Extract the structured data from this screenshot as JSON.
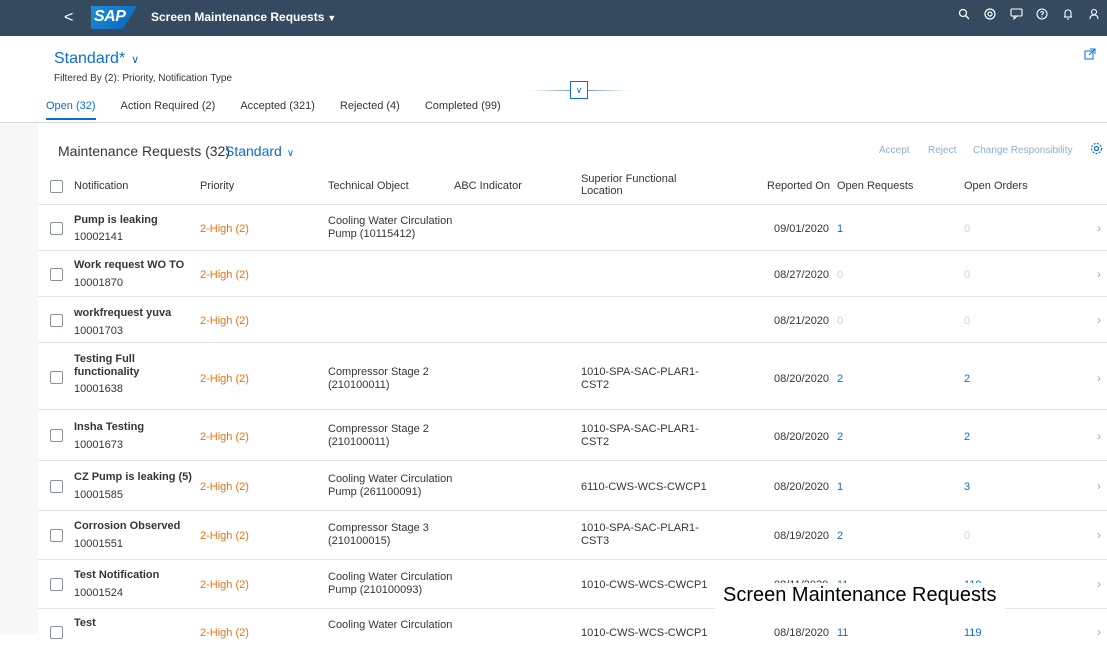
{
  "shell": {
    "back_icon": "<",
    "logo_text": "SAP",
    "app_title": "Screen Maintenance Requests",
    "title_caret": "▼",
    "actions": [
      "search-icon",
      "copilot-icon",
      "notifications-chat-icon",
      "help-icon",
      "bell-icon",
      "user-icon"
    ]
  },
  "header": {
    "variant_name": "Standard*",
    "variant_chevron": "∨",
    "filtered_by": "Filtered By (2): Priority, Notification Type",
    "share_icon": "↗",
    "collapse_icon": "∨",
    "tabs": [
      {
        "label": "Open (32)",
        "active": true
      },
      {
        "label": "Action Required (2)",
        "active": false
      },
      {
        "label": "Accepted (321)",
        "active": false
      },
      {
        "label": "Rejected (4)",
        "active": false
      },
      {
        "label": "Completed (99)",
        "active": false
      }
    ]
  },
  "table": {
    "title": "Maintenance Requests (32)",
    "variant": "Standard",
    "variant_chevron": "∨",
    "actions": {
      "accept": "Accept",
      "reject": "Reject",
      "change_responsibility": "Change Responsibility"
    },
    "settings_icon": "⚙",
    "columns": {
      "notification": "Notification",
      "priority": "Priority",
      "technical_object": "Technical Object",
      "abc_indicator": "ABC Indicator",
      "superior_functional_location": "Superior Functional Location",
      "reported_on": "Reported On",
      "open_requests": "Open Requests",
      "open_orders": "Open Orders"
    },
    "rows": [
      {
        "title": "Pump is leaking",
        "id": "10002141",
        "priority": "2-High (2)",
        "technical_object": "Cooling Water Circulation Pump (10115412)",
        "functional_location": "",
        "reported_on": "09/01/2020",
        "open_requests": "1",
        "open_orders": "0"
      },
      {
        "title": "Work request WO TO",
        "id": "10001870",
        "priority": "2-High (2)",
        "technical_object": "",
        "functional_location": "",
        "reported_on": "08/27/2020",
        "open_requests": "0",
        "open_orders": "0"
      },
      {
        "title": "workfrequest yuva",
        "id": "10001703",
        "priority": "2-High (2)",
        "technical_object": "",
        "functional_location": "",
        "reported_on": "08/21/2020",
        "open_requests": "0",
        "open_orders": "0"
      },
      {
        "title": "Testing Full functionality",
        "id": "10001638",
        "priority": "2-High (2)",
        "technical_object": "Compressor Stage 2 (210100011)",
        "functional_location": "1010-SPA-SAC-PLAR1-CST2",
        "reported_on": "08/20/2020",
        "open_requests": "2",
        "open_orders": "2"
      },
      {
        "title": "Insha Testing",
        "id": "10001673",
        "priority": "2-High (2)",
        "technical_object": "Compressor Stage 2 (210100011)",
        "functional_location": "1010-SPA-SAC-PLAR1-CST2",
        "reported_on": "08/20/2020",
        "open_requests": "2",
        "open_orders": "2"
      },
      {
        "title": "CZ Pump is leaking (5)",
        "id": "10001585",
        "priority": "2-High (2)",
        "technical_object": "Cooling Water Circulation Pump (261100091)",
        "functional_location": "6110-CWS-WCS-CWCP1",
        "reported_on": "08/20/2020",
        "open_requests": "1",
        "open_orders": "3"
      },
      {
        "title": "Corrosion Observed",
        "id": "10001551",
        "priority": "2-High (2)",
        "technical_object": "Compressor Stage 3 (210100015)",
        "functional_location": "1010-SPA-SAC-PLAR1-CST3",
        "reported_on": "08/19/2020",
        "open_requests": "2",
        "open_orders": "0"
      },
      {
        "title": "Test Notification",
        "id": "10001524",
        "priority": "2-High (2)",
        "technical_object": "Cooling Water Circulation Pump (210100093)",
        "functional_location": "1010-CWS-WCS-CWCP1",
        "reported_on": "08/11/2020",
        "open_requests": "11",
        "open_orders": "119"
      },
      {
        "title": "Test",
        "id": "",
        "priority": "2-High (2)",
        "technical_object": "Cooling Water Circulation",
        "functional_location": "1010-CWS-WCS-CWCP1",
        "reported_on": "08/18/2020",
        "open_requests": "11",
        "open_orders": "119"
      }
    ],
    "row_nav_icon": "›"
  },
  "caption": "Screen Maintenance Requests",
  "colors": {
    "shell": "#354a5f",
    "link": "#0a6ed1",
    "priority_high": "#e9730c"
  }
}
